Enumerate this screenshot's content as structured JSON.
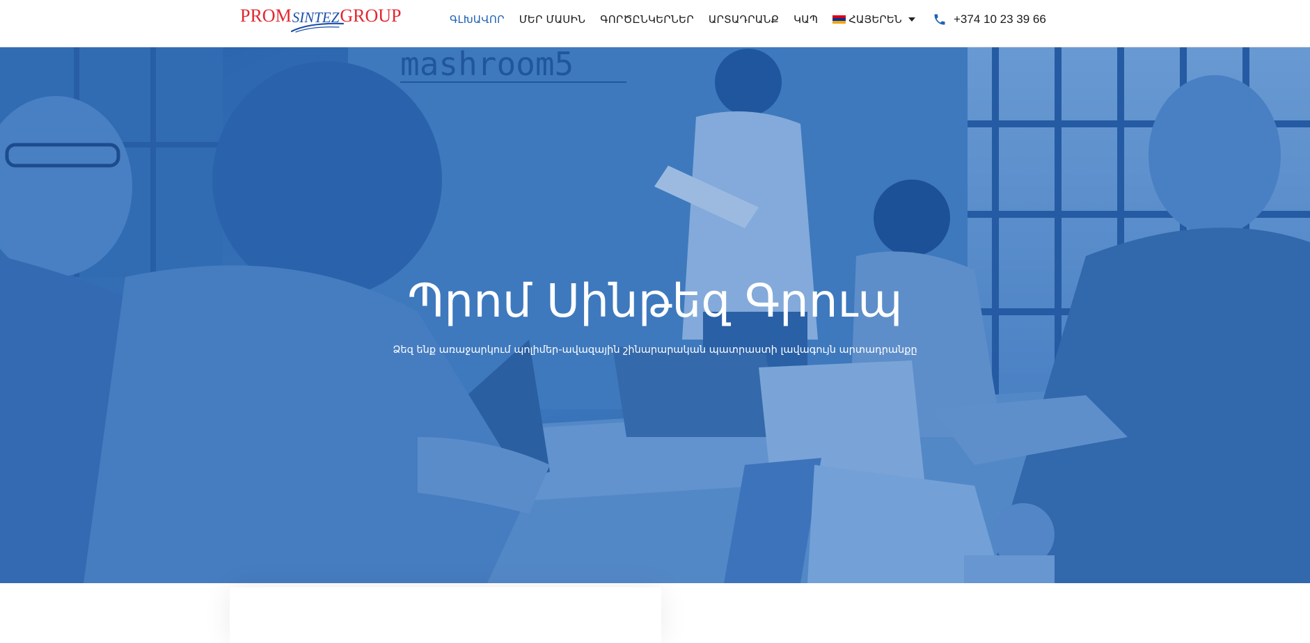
{
  "brand": {
    "logo_prom": "PROM",
    "logo_sintez": "SINTEZ",
    "logo_group": "GROUP",
    "colors": {
      "red": "#e2262f",
      "blue": "#1b4fa8"
    }
  },
  "nav": {
    "items": [
      {
        "label": "ԳԼԽԱՎՈՐ",
        "active": true
      },
      {
        "label": "ՄԵՐ ՄԱՍԻՆ",
        "active": false
      },
      {
        "label": "ԳՈՐԾԸՆԿԵՐՆԵՐ",
        "active": false
      },
      {
        "label": "ԱՐՏԱԴՐԱՆՔ",
        "active": false
      },
      {
        "label": "ԿԱՊ",
        "active": false
      }
    ],
    "language": {
      "label": "ՀԱՅԵՐԵՆ",
      "flag_colors": [
        "#d90012",
        "#0033a0",
        "#f2a800"
      ]
    },
    "active_color": "#1e63b5"
  },
  "contact": {
    "phone_icon": "phone-icon",
    "phone": "+374 10 23 39 66"
  },
  "hero": {
    "title": "Պրոմ Սինթեզ Գրուպ",
    "subtitle": "Ձեզ ենք առաջարկում պոլիմեր-ավազային շինարարական պատրաստի լավագույն արտադրանքը",
    "background_text": "mashroom5",
    "overlay_color": "#2f68b2"
  }
}
